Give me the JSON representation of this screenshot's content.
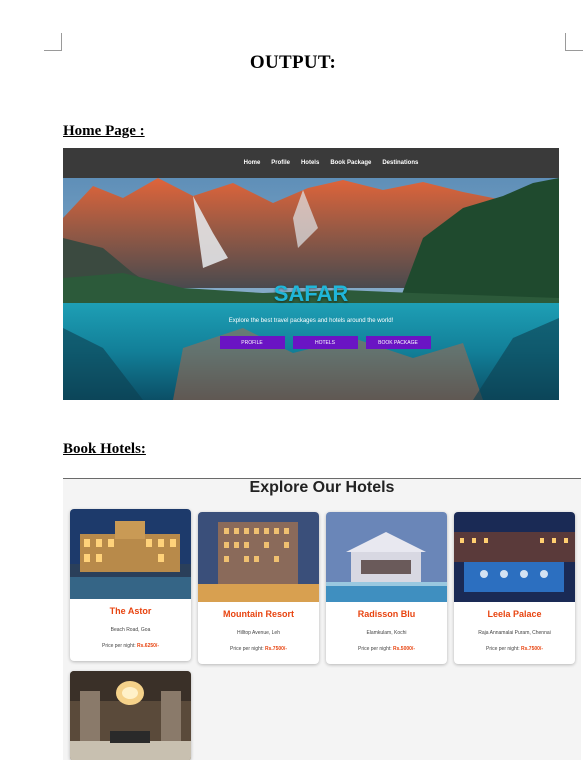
{
  "document": {
    "title": "OUTPUT:",
    "home_heading": "Home Page :",
    "hotels_heading": "Book Hotels:"
  },
  "home": {
    "nav": [
      "Home",
      "Profile",
      "Hotels",
      "Book Package",
      "Destinations"
    ],
    "hero_title": "SAFAR",
    "hero_subtitle": "Explore the best travel packages and hotels around the world!",
    "buttons": [
      "PROFILE",
      "HOTELS",
      "BOOK PACKAGE"
    ]
  },
  "hotels": {
    "title": "Explore Our Hotels",
    "price_label": "Price per night:",
    "cards": [
      {
        "name": "The Astor",
        "address": "Beach Road, Goa",
        "price": "Rs.6250/-"
      },
      {
        "name": "Mountain Resort",
        "address": "Hilltop Avenue, Leh",
        "price": "Rs.7500/-"
      },
      {
        "name": "Radisson Blu",
        "address": "Elamkulam, Kochi",
        "price": "Rs.5000/-"
      },
      {
        "name": "Leela Palace",
        "address": "Raja Annamalai Puram, Chennai",
        "price": "Rs.7500/-"
      }
    ]
  },
  "colors": {
    "accent_purple": "#6a14c4",
    "hotel_name": "#e84410",
    "hero_title": "#1fb6d9",
    "navbar": "#3a3a3a"
  }
}
